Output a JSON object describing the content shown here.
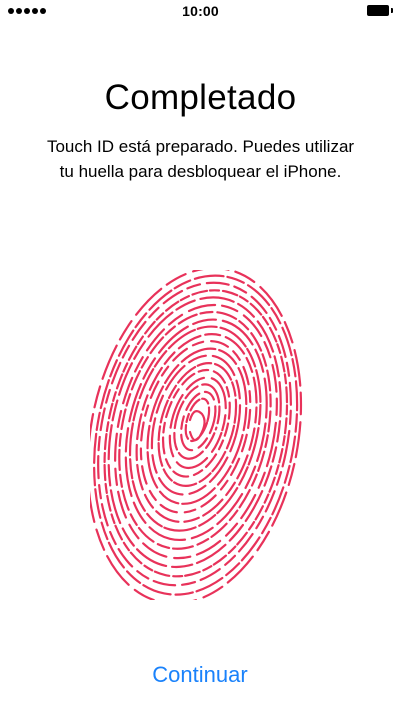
{
  "status_bar": {
    "time": "10:00",
    "signal_icon": "signal-dots-icon",
    "battery_icon": "battery-full-icon"
  },
  "main": {
    "title": "Completado",
    "subtitle_line1": "Touch ID está preparado. Puedes utilizar",
    "subtitle_line2": "tu huella para desbloquear el iPhone.",
    "fingerprint_icon": "fingerprint-icon",
    "fingerprint_color": "#e8325a"
  },
  "footer": {
    "continue_label": "Continuar",
    "accent_color": "#1a82fb"
  }
}
